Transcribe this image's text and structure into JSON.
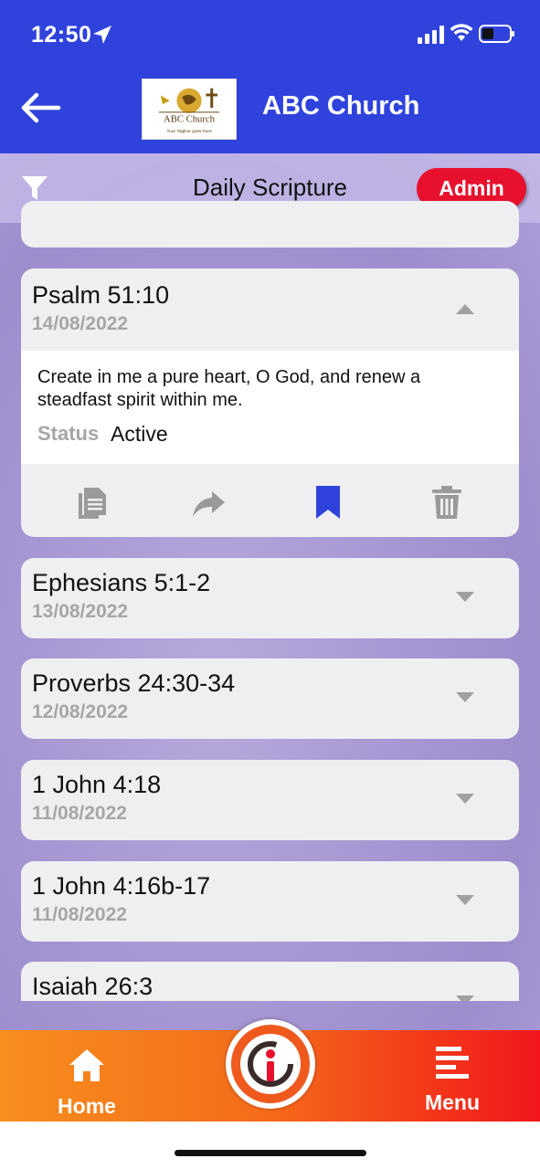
{
  "status_bar": {
    "time": "12:50"
  },
  "header": {
    "title": "ABC Church",
    "logo_text": "ABC Church",
    "logo_tagline": "Your Tagline goes here"
  },
  "subheader": {
    "title": "Daily Scripture",
    "admin_label": "Admin"
  },
  "expanded": {
    "title": "Psalm 51:10",
    "date": "14/08/2022",
    "text": "Create in me a pure heart, O God, and renew a steadfast spirit within me.",
    "status_label": "Status",
    "status_value": "Active"
  },
  "items": [
    {
      "title": "Ephesians 5:1-2",
      "date": "13/08/2022"
    },
    {
      "title": "Proverbs 24:30-34",
      "date": "12/08/2022"
    },
    {
      "title": "1 John 4:18",
      "date": "11/08/2022"
    },
    {
      "title": "1 John 4:16b-17",
      "date": "11/08/2022"
    },
    {
      "title": "Isaiah 26:3",
      "date": ""
    }
  ],
  "colors": {
    "header": "#2f43dc",
    "admin": "#e8112d",
    "bookmark": "#2f43dc",
    "icon_gray": "#9a9a9a"
  },
  "bottom_nav": {
    "home_label": "Home",
    "menu_label": "Menu"
  }
}
